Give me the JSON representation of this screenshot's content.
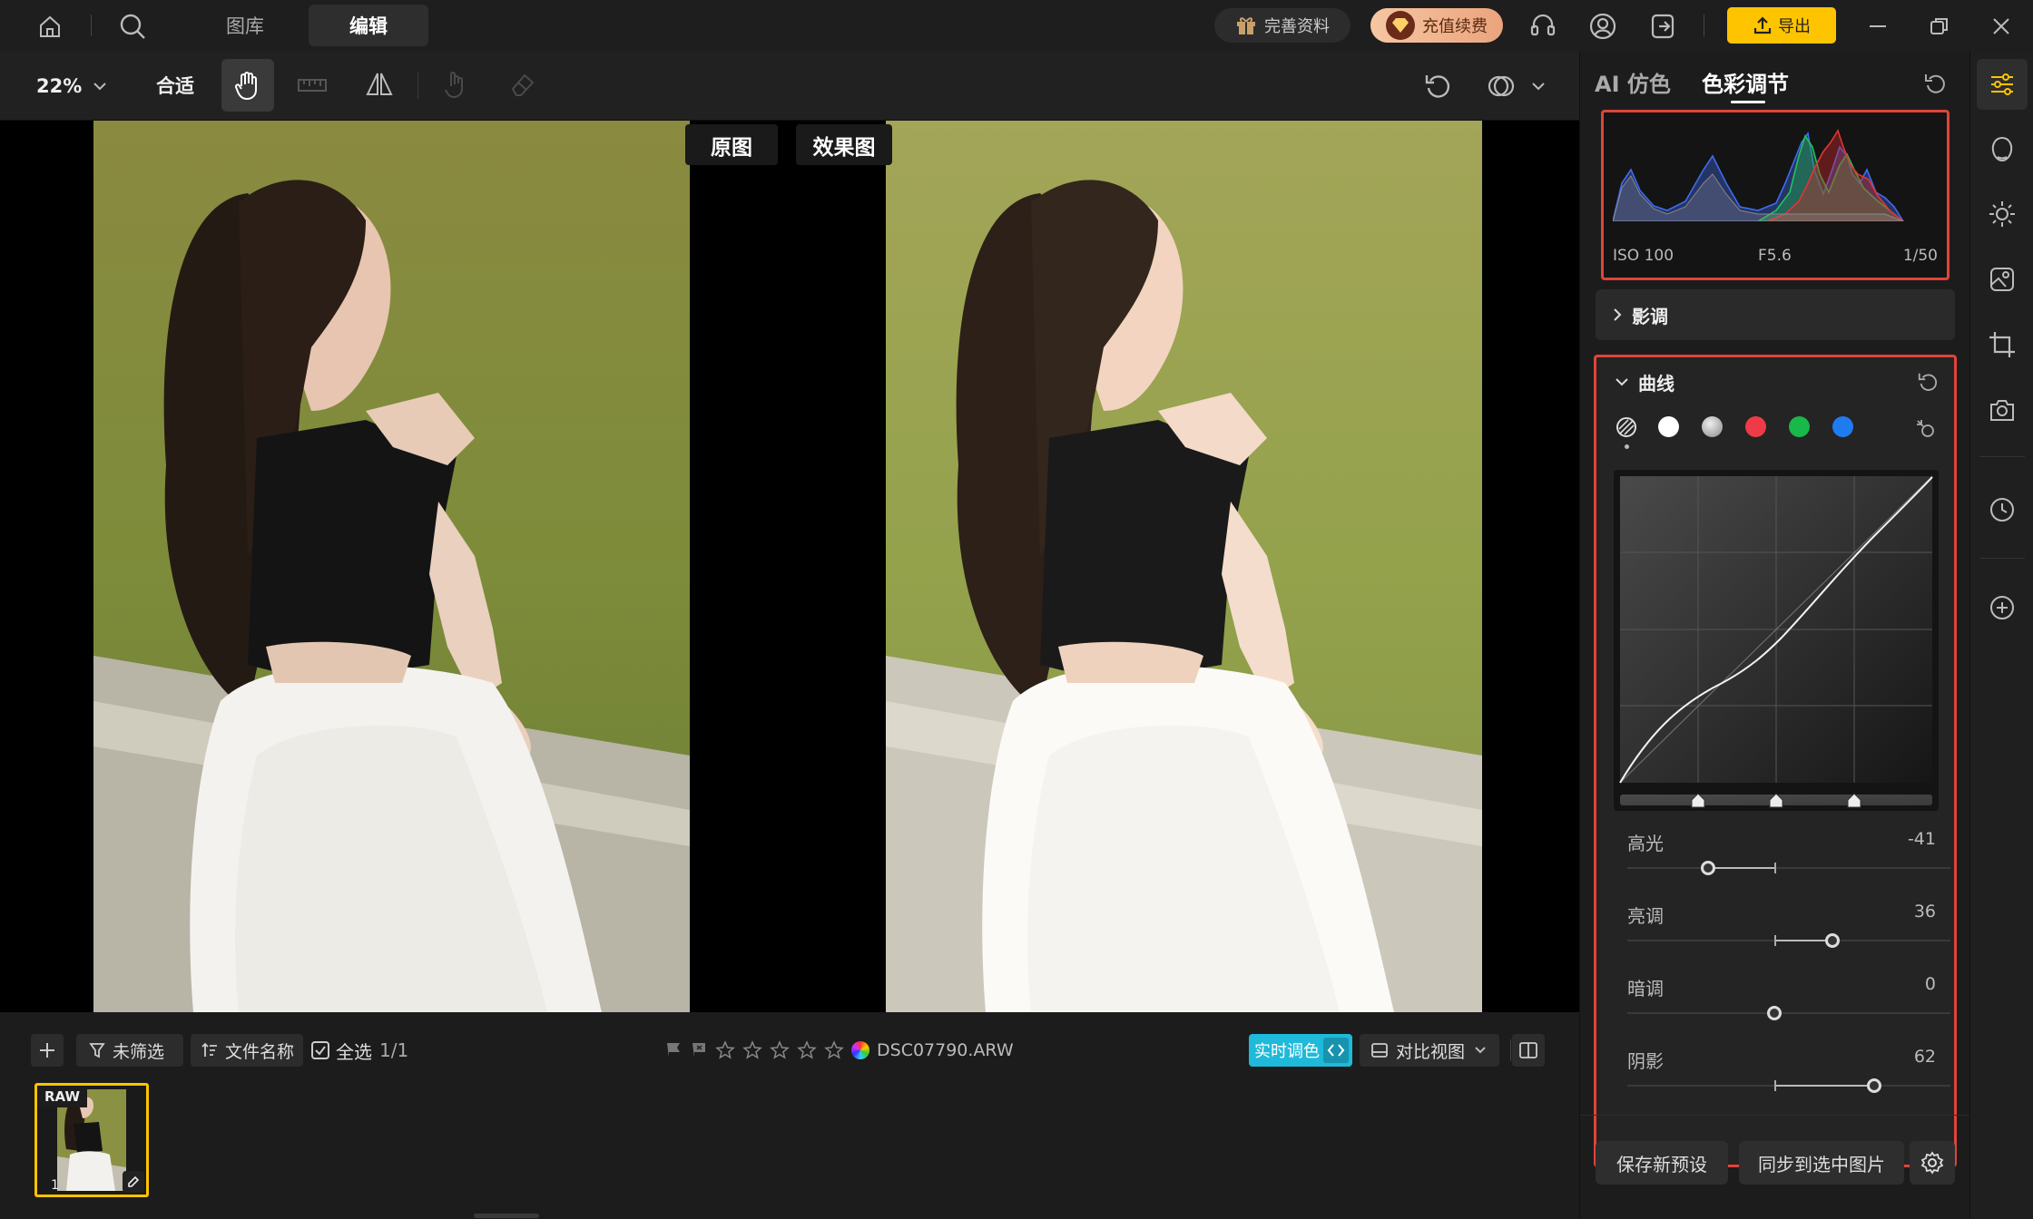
{
  "topbar": {
    "tabs": [
      {
        "label": "图库"
      },
      {
        "label": "编辑"
      }
    ],
    "active_tab": "编辑",
    "profile_label": "完善资料",
    "recharge_label": "充值续费",
    "export_label": "导出",
    "accent_color": "#ffc400"
  },
  "toolbar": {
    "zoom_value": "22%",
    "fit_label": "合适"
  },
  "canvas": {
    "original_label": "原图",
    "result_label": "效果图"
  },
  "bottombar": {
    "filter_label": "未筛选",
    "sort_label": "文件名称",
    "select_all_label": "全选",
    "select_count": "1/1",
    "filename": "DSC07790.ARW",
    "realtime_label": "实时调色",
    "compare_label": "对比视图",
    "thumb_badge": "RAW",
    "thumb_index": "1",
    "realtime_color": "#1fb9d9"
  },
  "panel": {
    "tabs": [
      {
        "label": "AI 仿色"
      },
      {
        "label": "色彩调节"
      }
    ],
    "histogram": {
      "iso": "ISO 100",
      "aperture": "F5.6",
      "shutter": "1/50"
    },
    "tone_section": "影调",
    "curve_section": "曲线",
    "curve_channels": [
      "luminance",
      "white",
      "gray",
      "red",
      "green",
      "blue"
    ],
    "sliders": [
      {
        "label": "高光",
        "value": "-41",
        "level": -41
      },
      {
        "label": "亮调",
        "value": "36",
        "level": 36
      },
      {
        "label": "暗调",
        "value": "0",
        "level": 0
      },
      {
        "label": "阴影",
        "value": "62",
        "level": 62
      }
    ],
    "save_preset_label": "保存新预设",
    "sync_label": "同步到选中图片",
    "highlight_color": "#e0443a"
  }
}
